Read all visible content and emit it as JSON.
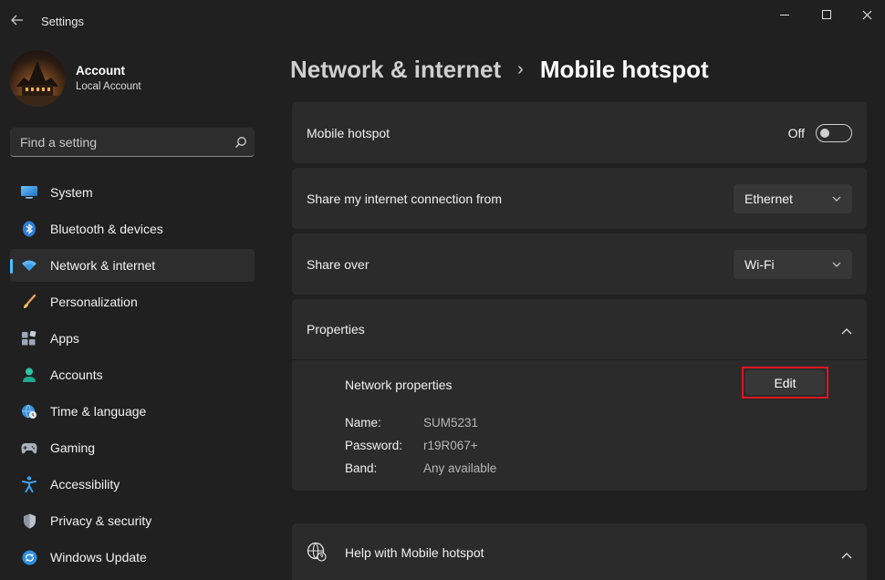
{
  "window": {
    "app_title": "Settings"
  },
  "account": {
    "name": "Account",
    "type": "Local Account"
  },
  "search": {
    "placeholder": "Find a setting"
  },
  "nav": {
    "items": [
      {
        "label": "System",
        "icon": "system-icon",
        "active": false
      },
      {
        "label": "Bluetooth & devices",
        "icon": "bluetooth-icon",
        "active": false
      },
      {
        "label": "Network & internet",
        "icon": "wifi-icon",
        "active": true
      },
      {
        "label": "Personalization",
        "icon": "brush-icon",
        "active": false
      },
      {
        "label": "Apps",
        "icon": "apps-icon",
        "active": false
      },
      {
        "label": "Accounts",
        "icon": "person-icon",
        "active": false
      },
      {
        "label": "Time & language",
        "icon": "globe-clock-icon",
        "active": false
      },
      {
        "label": "Gaming",
        "icon": "gamepad-icon",
        "active": false
      },
      {
        "label": "Accessibility",
        "icon": "accessibility-icon",
        "active": false
      },
      {
        "label": "Privacy & security",
        "icon": "shield-icon",
        "active": false
      },
      {
        "label": "Windows Update",
        "icon": "update-icon",
        "active": false
      }
    ]
  },
  "breadcrumb": {
    "parent": "Network & internet",
    "separator": "›",
    "current": "Mobile hotspot"
  },
  "hotspot": {
    "label": "Mobile hotspot",
    "state": "Off"
  },
  "share_from": {
    "label": "Share my internet connection from",
    "value": "Ethernet"
  },
  "share_over": {
    "label": "Share over",
    "value": "Wi-Fi"
  },
  "properties": {
    "title": "Properties",
    "network_properties_label": "Network properties",
    "edit_label": "Edit",
    "rows": [
      {
        "key": "Name:",
        "value": "SUM5231"
      },
      {
        "key": "Password:",
        "value": "r19R067+"
      },
      {
        "key": "Band:",
        "value": "Any available"
      }
    ]
  },
  "help": {
    "label": "Help with Mobile hotspot"
  },
  "colors": {
    "background": "#202020",
    "card": "#2b2b2b",
    "accent": "#4cc2ff",
    "highlight_box": "#e0141e"
  }
}
